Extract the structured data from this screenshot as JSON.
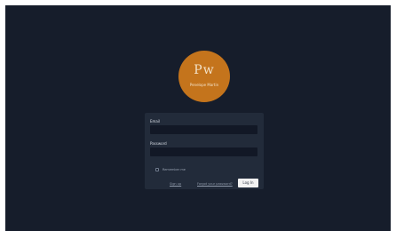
{
  "brand": {
    "logo_mark": "Pw",
    "logo_name": "Penelope Martin",
    "logo_color": "#c4741c"
  },
  "login_form": {
    "email_label": "Email",
    "email_value": "",
    "password_label": "Password",
    "password_value": "",
    "remember_label": "Remember me",
    "remember_checked": false,
    "forgot_link": "Forgot your password?",
    "register_link": "Sign up",
    "login_button": "Log In"
  },
  "colors": {
    "background": "#161d2b",
    "panel": "#222b3a",
    "input": "#121826"
  }
}
